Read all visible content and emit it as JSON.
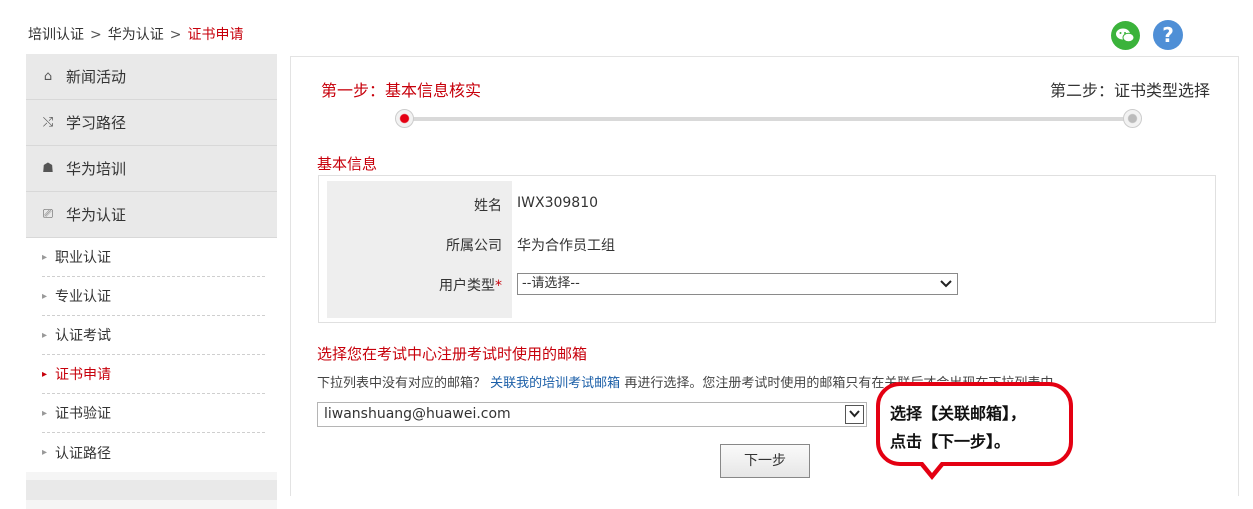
{
  "breadcrumb": {
    "items": [
      "培训认证",
      "华为认证"
    ],
    "separator": ">",
    "current": "证书申请"
  },
  "header_icons": {
    "wechat": "wechat-icon",
    "help": "?"
  },
  "sidebar": {
    "main_items": [
      {
        "label": "新闻活动",
        "icon": "⌂"
      },
      {
        "label": "学习路径",
        "icon": "⤭"
      },
      {
        "label": "华为培训",
        "icon": "☗"
      },
      {
        "label": "华为认证",
        "icon": "⎚"
      }
    ],
    "sub_items": [
      {
        "label": "职业认证"
      },
      {
        "label": "专业认证"
      },
      {
        "label": "认证考试"
      },
      {
        "label": "证书申请"
      },
      {
        "label": "证书验证"
      },
      {
        "label": "认证路径"
      }
    ]
  },
  "steps": {
    "step1": "第一步：基本信息核实",
    "step2": "第二步：证书类型选择"
  },
  "basic_info": {
    "title": "基本信息",
    "name_label": "姓名",
    "name_value": "IWX309810",
    "company_label": "所属公司",
    "company_value": "华为合作员工组",
    "user_type_label": "用户类型",
    "required_mark": "*",
    "user_type_value": "--请选择--"
  },
  "email": {
    "title": "选择您在考试中心注册考试时使用的邮箱",
    "hint_prefix": "下拉列表中没有对应的邮箱？",
    "hint_link": "关联我的培训考试邮箱",
    "hint_suffix": "再进行选择。您注册考试时使用的邮箱只有在关联后才会出现在下拉列表中。",
    "selected": "liwanshuang@huawei.com"
  },
  "next_button": "下一步",
  "callout": {
    "line1": "选择【关联邮箱】，",
    "line2": "点击【下一步】。"
  },
  "colors": {
    "accent_red": "#c7000b",
    "link_blue": "#1b5fa8",
    "wechat_green": "#3bb33b",
    "help_blue": "#4f8fd6"
  }
}
